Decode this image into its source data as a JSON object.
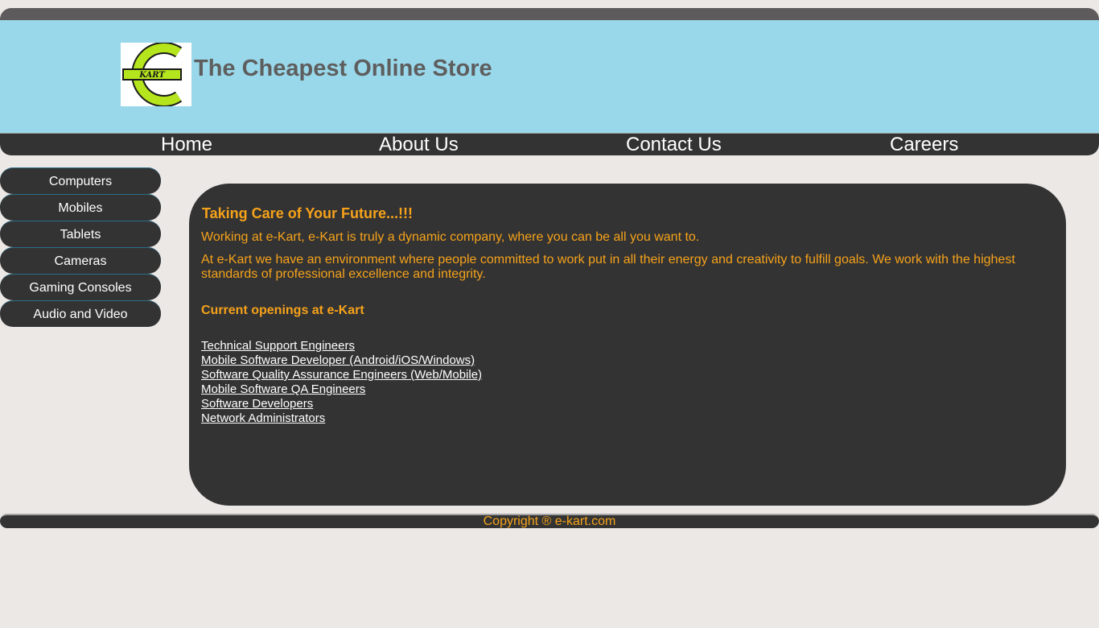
{
  "header": {
    "logo_text": "KART",
    "title": "The Cheapest Online Store"
  },
  "nav": {
    "items": [
      {
        "label": "Home"
      },
      {
        "label": "About Us"
      },
      {
        "label": "Contact Us"
      },
      {
        "label": "Careers"
      }
    ]
  },
  "sidebar": {
    "items": [
      {
        "label": "Computers"
      },
      {
        "label": "Mobiles"
      },
      {
        "label": "Tablets"
      },
      {
        "label": "Cameras"
      },
      {
        "label": "Gaming Consoles"
      },
      {
        "label": "Audio and Video"
      }
    ]
  },
  "content": {
    "heading": "Taking Care of Your Future...!!!",
    "intro": "Working at e-Kart, e-Kart is truly a dynamic company, where you can be all you want to.",
    "description": "At e-Kart we have an environment where people committed to work put in all their energy and creativity to fulfill goals. We work with the highest standards of professional excellence and integrity.",
    "openings_heading": "Current openings at e-Kart",
    "openings": [
      {
        "label": "Technical Support Engineers"
      },
      {
        "label": "Mobile Software Developer (Android/iOS/Windows)"
      },
      {
        "label": "Software Quality Assurance Engineers (Web/Mobile)"
      },
      {
        "label": "Mobile Software QA Engineers"
      },
      {
        "label": "Software Developers"
      },
      {
        "label": "Network Administrators"
      }
    ]
  },
  "footer": {
    "copyright": "Copyright ® e-kart.com"
  },
  "colors": {
    "header_bg": "#99d8ea",
    "dark_bg": "#333333",
    "accent_orange": "#f6a21a",
    "logo_green": "#b5e61d",
    "title_gray": "#5e5e5e",
    "page_bg": "#ece8e6"
  }
}
